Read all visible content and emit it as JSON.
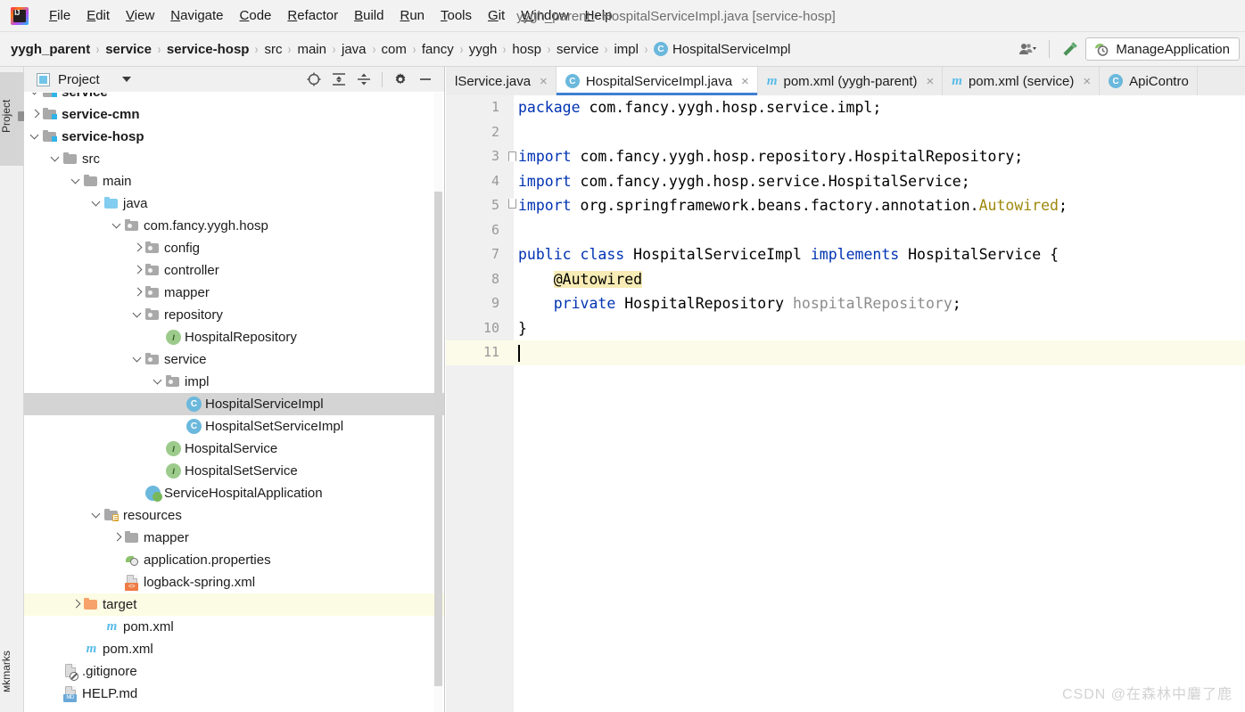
{
  "window": {
    "title": "yygh_parent - HospitalServiceImpl.java [service-hosp]",
    "app_icon": "intellij-idea-logo"
  },
  "menubar": {
    "items": [
      {
        "label": "File",
        "mnemonic": "F"
      },
      {
        "label": "Edit",
        "mnemonic": "E"
      },
      {
        "label": "View",
        "mnemonic": "V"
      },
      {
        "label": "Navigate",
        "mnemonic": "N"
      },
      {
        "label": "Code",
        "mnemonic": "C"
      },
      {
        "label": "Refactor",
        "mnemonic": "R"
      },
      {
        "label": "Build",
        "mnemonic": "B"
      },
      {
        "label": "Run",
        "mnemonic": "R"
      },
      {
        "label": "Tools",
        "mnemonic": "T"
      },
      {
        "label": "Git",
        "mnemonic": "G"
      },
      {
        "label": "Window",
        "mnemonic": "W"
      },
      {
        "label": "Help",
        "mnemonic": "H"
      }
    ]
  },
  "navbar": {
    "crumbs": [
      {
        "label": "yygh_parent",
        "bold": true,
        "icon": "none"
      },
      {
        "label": "service",
        "bold": true,
        "icon": "none"
      },
      {
        "label": "service-hosp",
        "bold": true,
        "icon": "none"
      },
      {
        "label": "src",
        "bold": false,
        "icon": "none"
      },
      {
        "label": "main",
        "bold": false,
        "icon": "none"
      },
      {
        "label": "java",
        "bold": false,
        "icon": "none"
      },
      {
        "label": "com",
        "bold": false,
        "icon": "none"
      },
      {
        "label": "fancy",
        "bold": false,
        "icon": "none"
      },
      {
        "label": "yygh",
        "bold": false,
        "icon": "none"
      },
      {
        "label": "hosp",
        "bold": false,
        "icon": "none"
      },
      {
        "label": "service",
        "bold": false,
        "icon": "none"
      },
      {
        "label": "impl",
        "bold": false,
        "icon": "none"
      },
      {
        "label": "HospitalServiceImpl",
        "bold": false,
        "icon": "class-badge"
      }
    ],
    "separator": "›",
    "user_icon": "user-dropdown-icon",
    "build_icon": "hammer-build-icon",
    "run_config": {
      "label": "ManageApplication",
      "icon": "spring-boot-run-icon"
    }
  },
  "toolstrip": {
    "top_button": "Project",
    "bottom_button": "мkmarks"
  },
  "project_panel": {
    "title": "Project",
    "title_icon": "project-view-icon",
    "dropdown_icon": "chevron-down-icon",
    "actions": [
      {
        "name": "locate-icon",
        "glyph": "target"
      },
      {
        "name": "expand-all-icon",
        "glyph": "expand"
      },
      {
        "name": "collapse-all-icon",
        "glyph": "collapse"
      },
      {
        "name": "settings-gear-icon",
        "glyph": "gear"
      },
      {
        "name": "hide-panel-icon",
        "glyph": "minus"
      }
    ],
    "tree": [
      {
        "label": "service",
        "indent": 1,
        "arrow": "open",
        "icon": "module-folder",
        "bold": true,
        "state": "clipped"
      },
      {
        "label": "service-cmn",
        "indent": 1,
        "arrow": "closed",
        "icon": "module-folder",
        "bold": true,
        "state": "normal"
      },
      {
        "label": "service-hosp",
        "indent": 1,
        "arrow": "open",
        "icon": "module-folder",
        "bold": true,
        "state": "normal"
      },
      {
        "label": "src",
        "indent": 2,
        "arrow": "open",
        "icon": "grey-folder",
        "bold": false,
        "state": "normal"
      },
      {
        "label": "main",
        "indent": 3,
        "arrow": "open",
        "icon": "grey-folder",
        "bold": false,
        "state": "normal"
      },
      {
        "label": "java",
        "indent": 4,
        "arrow": "open",
        "icon": "source-folder",
        "bold": false,
        "state": "normal"
      },
      {
        "label": "com.fancy.yygh.hosp",
        "indent": 5,
        "arrow": "open",
        "icon": "package-folder",
        "bold": false,
        "state": "normal"
      },
      {
        "label": "config",
        "indent": 6,
        "arrow": "closed",
        "icon": "package-folder",
        "bold": false,
        "state": "normal"
      },
      {
        "label": "controller",
        "indent": 6,
        "arrow": "closed",
        "icon": "package-folder",
        "bold": false,
        "state": "normal"
      },
      {
        "label": "mapper",
        "indent": 6,
        "arrow": "closed",
        "icon": "package-folder",
        "bold": false,
        "state": "normal"
      },
      {
        "label": "repository",
        "indent": 6,
        "arrow": "open",
        "icon": "package-folder",
        "bold": false,
        "state": "normal"
      },
      {
        "label": "HospitalRepository",
        "indent": 7,
        "arrow": "none",
        "icon": "interface-badge",
        "bold": false,
        "state": "normal"
      },
      {
        "label": "service",
        "indent": 6,
        "arrow": "open",
        "icon": "package-folder",
        "bold": false,
        "state": "normal"
      },
      {
        "label": "impl",
        "indent": 7,
        "arrow": "open",
        "icon": "package-folder",
        "bold": false,
        "state": "normal"
      },
      {
        "label": "HospitalServiceImpl",
        "indent": 8,
        "arrow": "none",
        "icon": "class-badge",
        "bold": false,
        "state": "selected"
      },
      {
        "label": "HospitalSetServiceImpl",
        "indent": 8,
        "arrow": "none",
        "icon": "class-badge",
        "bold": false,
        "state": "normal"
      },
      {
        "label": "HospitalService",
        "indent": 7,
        "arrow": "none",
        "icon": "interface-badge",
        "bold": false,
        "state": "normal"
      },
      {
        "label": "HospitalSetService",
        "indent": 7,
        "arrow": "none",
        "icon": "interface-badge",
        "bold": false,
        "state": "normal"
      },
      {
        "label": "ServiceHospitalApplication",
        "indent": 6,
        "arrow": "none",
        "icon": "spring-boot-class",
        "bold": false,
        "state": "normal"
      },
      {
        "label": "resources",
        "indent": 4,
        "arrow": "open",
        "icon": "resources-folder",
        "bold": false,
        "state": "normal"
      },
      {
        "label": "mapper",
        "indent": 5,
        "arrow": "closed",
        "icon": "grey-folder",
        "bold": false,
        "state": "normal"
      },
      {
        "label": "application.properties",
        "indent": 5,
        "arrow": "none",
        "icon": "spring-properties",
        "bold": false,
        "state": "normal"
      },
      {
        "label": "logback-spring.xml",
        "indent": 5,
        "arrow": "none",
        "icon": "xml-file",
        "bold": false,
        "state": "normal"
      },
      {
        "label": "target",
        "indent": 3,
        "arrow": "closed",
        "icon": "orange-folder",
        "bold": false,
        "state": "highlighted"
      },
      {
        "label": "pom.xml",
        "indent": 4,
        "arrow": "none",
        "icon": "maven-file",
        "bold": false,
        "state": "normal"
      },
      {
        "label": "pom.xml",
        "indent": 3,
        "arrow": "none",
        "icon": "maven-file",
        "bold": false,
        "state": "normal"
      },
      {
        "label": ".gitignore",
        "indent": 2,
        "arrow": "none",
        "icon": "gitignore-file",
        "bold": false,
        "state": "normal"
      },
      {
        "label": "HELP.md",
        "indent": 2,
        "arrow": "none",
        "icon": "markdown-file",
        "bold": false,
        "state": "normal"
      }
    ]
  },
  "editor_tabs": [
    {
      "label": "lService.java",
      "icon": "none",
      "active": false,
      "close_glyph": "×",
      "partial": true
    },
    {
      "label": "HospitalServiceImpl.java",
      "icon": "class-badge",
      "active": true,
      "close_glyph": "×",
      "partial": false
    },
    {
      "label": "pom.xml (yygh-parent)",
      "icon": "maven-file",
      "active": false,
      "close_glyph": "×",
      "partial": false
    },
    {
      "label": "pom.xml (service)",
      "icon": "maven-file",
      "active": false,
      "close_glyph": "×",
      "partial": false
    },
    {
      "label": "ApiContro",
      "icon": "class-badge",
      "active": false,
      "close_glyph": "",
      "partial": true
    }
  ],
  "code": {
    "language": "java",
    "current_line": 11,
    "lines": [
      {
        "num": 1,
        "fold": "none",
        "current": false,
        "tokens": [
          {
            "t": "package",
            "c": "kw"
          },
          {
            "t": " com.fancy.yygh.hosp.service.impl;",
            "c": "plain"
          }
        ]
      },
      {
        "num": 2,
        "fold": "none",
        "current": false,
        "tokens": []
      },
      {
        "num": 3,
        "fold": "start",
        "current": false,
        "tokens": [
          {
            "t": "import",
            "c": "kw"
          },
          {
            "t": " com.fancy.yygh.hosp.repository.HospitalRepository;",
            "c": "plain"
          }
        ]
      },
      {
        "num": 4,
        "fold": "none",
        "current": false,
        "tokens": [
          {
            "t": "import",
            "c": "kw"
          },
          {
            "t": " com.fancy.yygh.hosp.service.HospitalService;",
            "c": "plain"
          }
        ]
      },
      {
        "num": 5,
        "fold": "end",
        "current": false,
        "tokens": [
          {
            "t": "import",
            "c": "kw"
          },
          {
            "t": " org.springframework.beans.factory.annotation.",
            "c": "plain"
          },
          {
            "t": "Autowired",
            "c": "ann"
          },
          {
            "t": ";",
            "c": "plain"
          }
        ]
      },
      {
        "num": 6,
        "fold": "none",
        "current": false,
        "tokens": []
      },
      {
        "num": 7,
        "fold": "none",
        "current": false,
        "tokens": [
          {
            "t": "public class",
            "c": "kw"
          },
          {
            "t": " HospitalServiceImpl ",
            "c": "plain"
          },
          {
            "t": "implements",
            "c": "kw"
          },
          {
            "t": " HospitalService {",
            "c": "plain"
          }
        ]
      },
      {
        "num": 8,
        "fold": "none",
        "current": false,
        "tokens": [
          {
            "t": "    ",
            "c": "plain"
          },
          {
            "t": "@Autowired",
            "c": "annhl"
          }
        ]
      },
      {
        "num": 9,
        "fold": "none",
        "current": false,
        "tokens": [
          {
            "t": "    ",
            "c": "plain"
          },
          {
            "t": "private",
            "c": "kw"
          },
          {
            "t": " HospitalRepository ",
            "c": "plain"
          },
          {
            "t": "hospitalRepository",
            "c": "fld"
          },
          {
            "t": ";",
            "c": "plain"
          }
        ]
      },
      {
        "num": 10,
        "fold": "none",
        "current": false,
        "tokens": [
          {
            "t": "}",
            "c": "plain"
          }
        ]
      },
      {
        "num": 11,
        "fold": "none",
        "current": true,
        "tokens": []
      }
    ]
  },
  "watermark": "CSDN @在森林中麏了鹿",
  "colors": {
    "accent_tab": "#3f7fd1",
    "selection": "#d4d4d4",
    "highlight_row": "#fcfce4",
    "keyword": "#0033b3",
    "annotation": "#9e880d",
    "field": "#8c8c8c",
    "annotation_highlight": "#f7ecb5",
    "titlebar_bg": "#f2f2f2",
    "gutter_bg": "#f0f0f0"
  }
}
